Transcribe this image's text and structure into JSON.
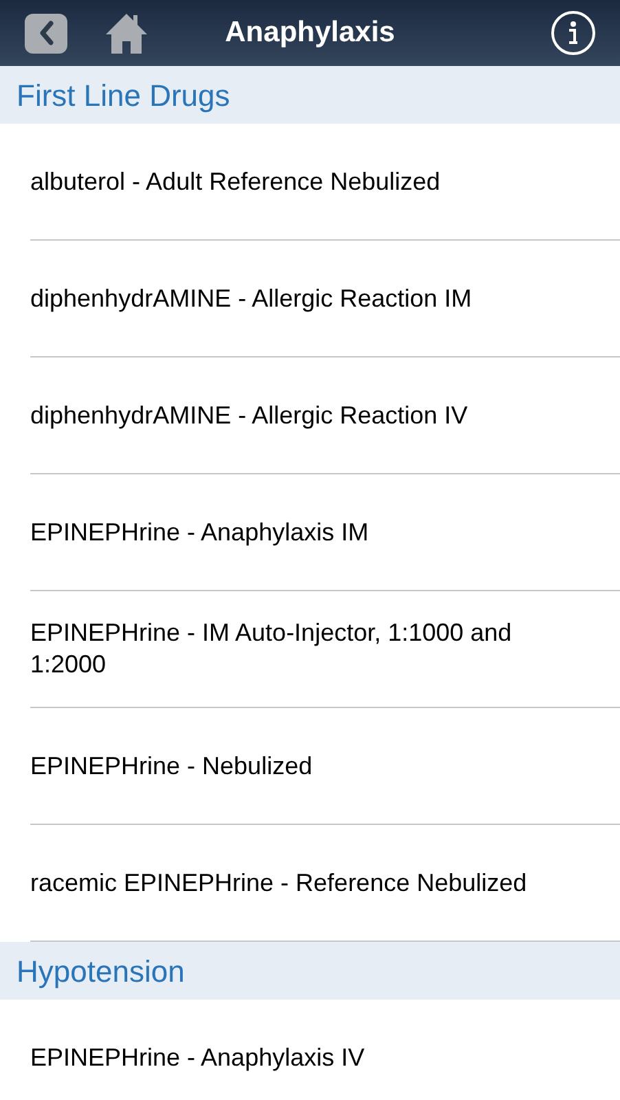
{
  "nav_bar": {
    "title": "Anaphylaxis"
  },
  "sections": [
    {
      "title": "First Line Drugs",
      "items": [
        "albuterol - Adult Reference Nebulized",
        "diphenhydrAMINE - Allergic Reaction IM",
        "diphenhydrAMINE - Allergic Reaction IV",
        "EPINEPHrine - Anaphylaxis IM",
        "EPINEPHrine - IM Auto-Injector, 1:1000 and 1:2000",
        "EPINEPHrine - Nebulized",
        "racemic EPINEPHrine - Reference Nebulized"
      ]
    },
    {
      "title": "Hypotension",
      "items": [
        "EPINEPHrine - Anaphylaxis IV"
      ]
    }
  ]
}
